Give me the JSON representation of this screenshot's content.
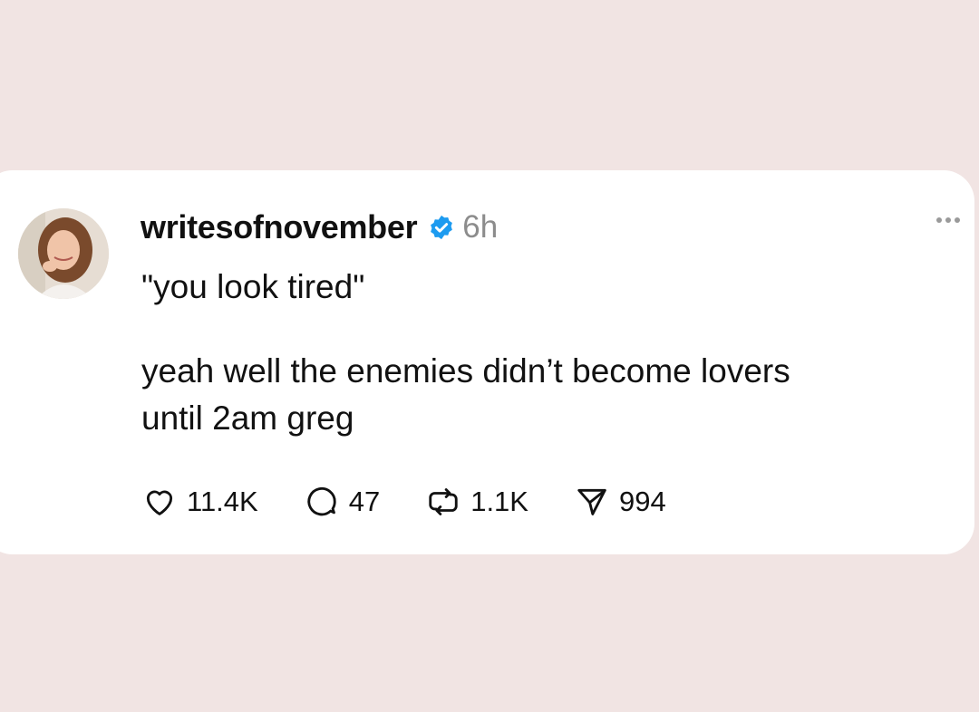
{
  "post": {
    "username": "writesofnovember",
    "time": "6h",
    "quote": "\"you look tired\"",
    "body_line1": "yeah well the enemies didn’t become lovers",
    "body_line2": "until 2am greg"
  },
  "actions": {
    "likes": "11.4K",
    "replies": "47",
    "reposts": "1.1K",
    "shares": "994"
  },
  "icons": {
    "verified": "verified-badge-icon",
    "like": "heart-icon",
    "reply": "speech-bubble-icon",
    "repost": "repost-arrows-icon",
    "share": "send-icon",
    "more": "more-options-icon"
  },
  "colors": {
    "background": "#f1e4e3",
    "card": "#ffffff",
    "verified": "#1d9bf0",
    "muted": "#8c8c8c"
  }
}
